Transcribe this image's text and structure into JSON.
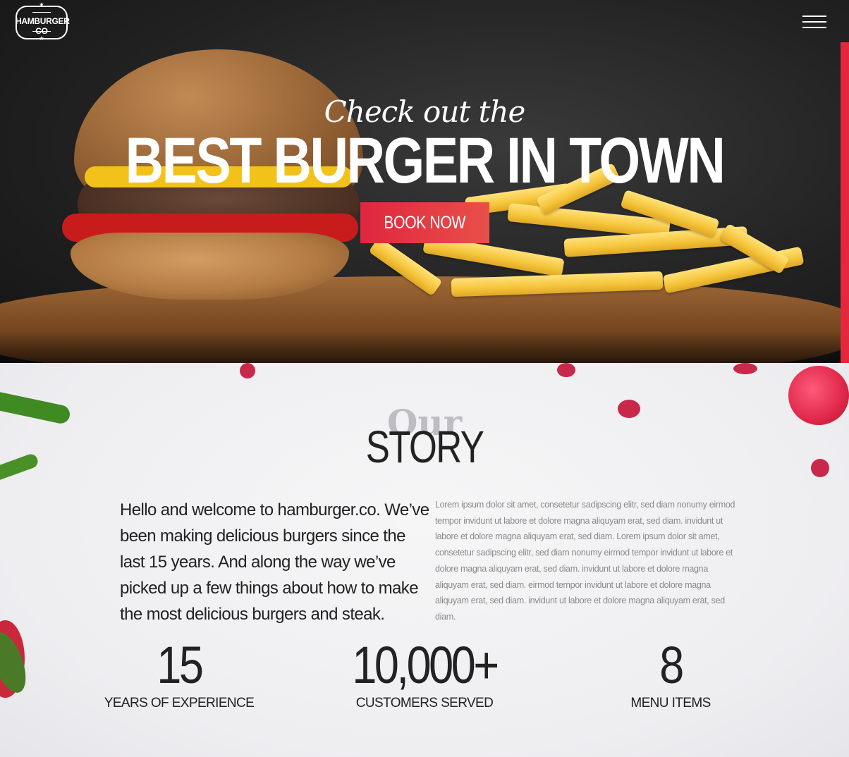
{
  "header": {
    "logo_text": "HAMBURGER CO",
    "menu_icon": "hamburger-menu-icon"
  },
  "hero": {
    "tagline": "Check out the",
    "headline": "BEST BURGER IN TOWN",
    "cta_label": "BOOK NOW",
    "accent_color": "#e3283e"
  },
  "story": {
    "title_script": "Our",
    "title": "STORY",
    "intro": "Hello and welcome to hamburger.co. We’ve been making delicious burgers since the last 15 years. And along the way we’ve picked up a few things about how to make the most delicious burgers and steak.",
    "body": "Lorem ipsum dolor sit amet, consetetur sadipscing elitr, sed diam nonumy eirmod tempor invidunt ut labore et dolore magna aliquyam erat, sed diam. invidunt ut labore et dolore magna aliquyam erat, sed diam. Lorem ipsum dolor sit amet, consetetur sadipscing elitr, sed diam nonumy eirmod tempor invidunt ut labore et dolore magna aliquyam erat, sed diam. invidunt ut labore et dolore magna aliquyam erat, sed diam. eirmod tempor invidunt ut labore et dolore magna aliquyam erat, sed diam. invidunt ut labore et dolore magna aliquyam erat, sed diam."
  },
  "stats": [
    {
      "value": "15",
      "label": "YEARS OF EXPERIENCE"
    },
    {
      "value": "10,000+",
      "label": "CUSTOMERS SERVED"
    },
    {
      "value": "8",
      "label": "MENU ITEMS"
    }
  ]
}
